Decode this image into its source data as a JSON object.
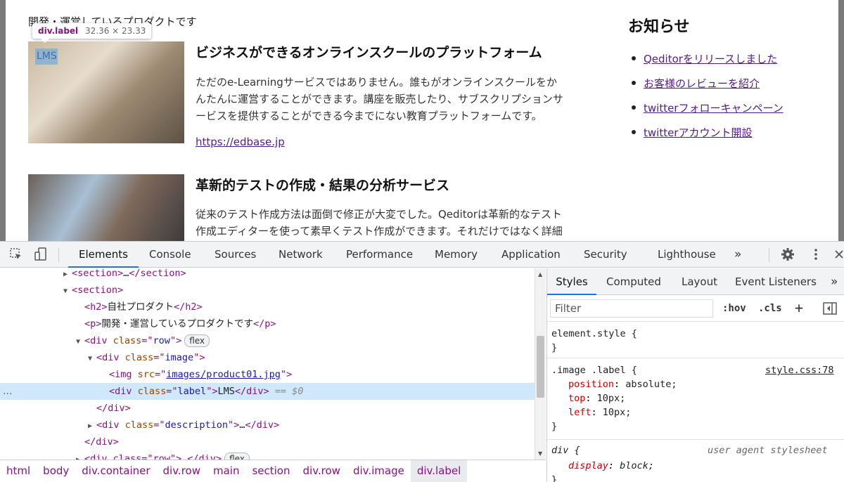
{
  "page": {
    "intro": "開発・運営しているプロダクトです",
    "tooltip": {
      "tag": "div.label",
      "size": "32.36 × 23.33"
    },
    "products": [
      {
        "label": "LMS",
        "title": "ビジネスができるオンラインスクールのプラットフォーム",
        "desc_lines": [
          "ただのe-Learningサービスではありません。誰もがオンラインスクールをか",
          "んたんに運営することができます。講座を販売したり、サブスクリプションサ",
          "ービスを提供することができる今までにない教育プラットフォームです。"
        ],
        "link": "https://edbase.jp"
      },
      {
        "title": "革新的テストの作成・結果の分析サービス",
        "desc_lines": [
          "従来のテスト作成方法は面倒で修正が大変でした。Qeditorは革新的なテスト",
          "作成エディターを使って素早くテスト作成ができます。それだけではなく詳細"
        ]
      }
    ],
    "news": {
      "title": "お知らせ",
      "items": [
        "Qeditorをリリースしました",
        "お客様のレビューを紹介",
        "twitterフォローキャンペーン",
        "twitterアカウント開設"
      ]
    }
  },
  "devtools": {
    "icons": [
      "inspect-icon",
      "device-toolbar-icon",
      "more-tabs-icon",
      "gear-icon",
      "kebab-menu-icon",
      "close-icon"
    ],
    "tabs": [
      "Elements",
      "Console",
      "Sources",
      "Network",
      "Performance",
      "Memory",
      "Application",
      "Security",
      "Lighthouse"
    ],
    "more_tabs": "»",
    "dom": {
      "l0_open": "<section>",
      "l0_ell": "…",
      "l0_close": "</section>",
      "l1": "<section>",
      "l2_open": "<h2>",
      "l2_text": "自社プロダクト",
      "l2_close": "</h2>",
      "l3_open": "<p>",
      "l3_text": "開発・運営しているプロダクトです",
      "l3_close": "</p>",
      "l4_pre": "<div ",
      "l4_attr": "class",
      "l4_eq": "=\"",
      "l4_val": "row",
      "l4_post": "\">",
      "l4_badge": "flex",
      "l5_pre": "<div ",
      "l5_attr": "class",
      "l5_eq": "=\"",
      "l5_val": "image",
      "l5_post": "\">",
      "l6_pre": "<img ",
      "l6_attr": "src",
      "l6_eq": "=\"",
      "l6_val": "images/product01.jpg",
      "l6_post": "\">",
      "l7_pre": "<div ",
      "l7_attr": "class",
      "l7_eq": "=\"",
      "l7_val": "label",
      "l7_mid": "\">",
      "l7_text": "LMS",
      "l7_close": "</div>",
      "l7_sel": " == $0",
      "l8": "</div>",
      "l9_pre": "<div ",
      "l9_attr": "class",
      "l9_eq": "=\"",
      "l9_val": "description",
      "l9_mid": "\">",
      "l9_ell": "…",
      "l9_close": "</div>",
      "l10": "</div>",
      "l11": "<div class=\"row\">…</div>",
      "l11_badge": "flex",
      "dots": "…"
    },
    "breadcrumbs": [
      "html",
      "body",
      "div.container",
      "div.row",
      "main",
      "section",
      "div.row",
      "div.image",
      "div.label"
    ],
    "styles": {
      "subtabs": [
        "Styles",
        "Computed",
        "Layout",
        "Event Listeners"
      ],
      "more": "»",
      "filter_placeholder": "Filter",
      "hov": ":hov",
      "cls": ".cls",
      "plus": "+",
      "element_style": "element.style {",
      "close_brace": "}",
      "rule1": {
        "selector": ".image .label {",
        "source": "style.css:78",
        "props": [
          {
            "name": "position",
            "value": "absolute;"
          },
          {
            "name": "top",
            "value": "10px;"
          },
          {
            "name": "left",
            "value": "10px;"
          }
        ]
      },
      "rule2": {
        "selector": "div {",
        "source": "user agent stylesheet",
        "props": [
          {
            "name": "display",
            "value": "block;"
          }
        ]
      }
    }
  }
}
